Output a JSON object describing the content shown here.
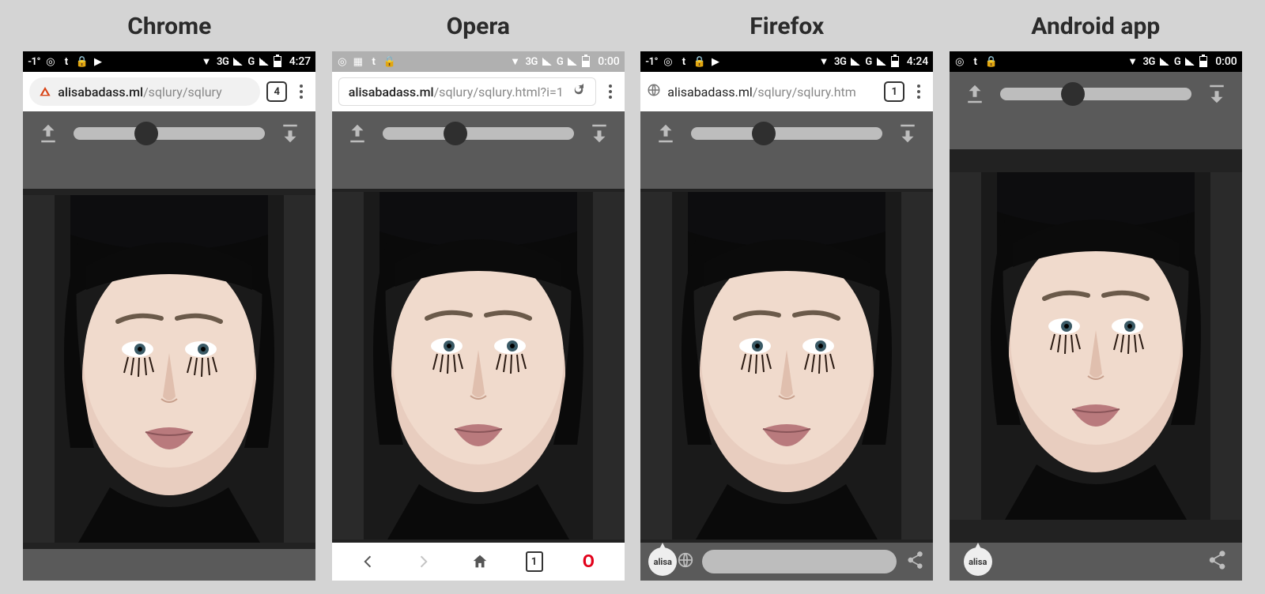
{
  "columns": [
    {
      "id": "chrome",
      "title": "Chrome",
      "status": {
        "temp": "-1°",
        "net": "3G",
        "carrier": "G",
        "time": "4:27"
      },
      "url": {
        "full": "alisabadass.ml/sqlury/sqlury",
        "domain": "alisabadass.ml",
        "path": "/sqlury/sqlury"
      },
      "tabs": "4"
    },
    {
      "id": "opera",
      "title": "Opera",
      "status": {
        "temp": "",
        "net": "3G",
        "carrier": "G",
        "time": "0:00"
      },
      "url": {
        "full": "alisabadass.ml/sqlury/sqlury.html?i=1",
        "domain": "alisabadass.ml",
        "path": "/sqlury/sqlury.html?i=1"
      },
      "nav": {
        "back": "←",
        "forward": "→",
        "home": "⌂",
        "tabs": "1",
        "opera": "O"
      }
    },
    {
      "id": "firefox",
      "title": "Firefox",
      "status": {
        "temp": "-1°",
        "net": "3G",
        "carrier": "G",
        "time": "4:24"
      },
      "url": {
        "full": "alisabadass.ml/sqlury/sqlury.htm",
        "domain": "alisabadass.ml",
        "path": "/sqlury/sqlury.htm"
      },
      "tabs": "1",
      "bottom": {
        "badge": "alisa"
      }
    },
    {
      "id": "android",
      "title": "Android app",
      "status": {
        "temp": "",
        "net": "3G",
        "carrier": "G",
        "time": "0:00"
      },
      "bottom": {
        "badge": "alisa"
      }
    }
  ],
  "icons": {
    "upload": "upload-icon",
    "download": "download-icon",
    "share": "share-icon",
    "globe": "globe-icon",
    "reload": "reload-icon",
    "warning": "warning-icon",
    "menu": "menu-icon"
  }
}
